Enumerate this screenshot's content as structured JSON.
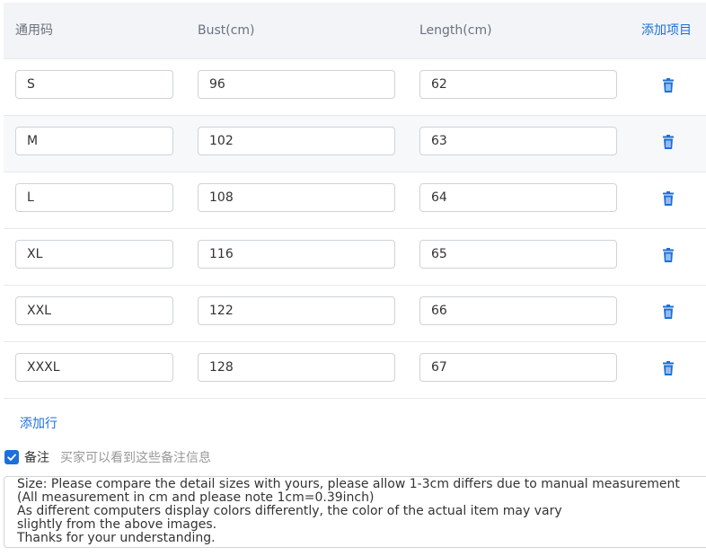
{
  "header": {
    "code_label": "通用码",
    "bust_label": "Bust(cm)",
    "length_label": "Length(cm)",
    "add_item_label": "添加项目"
  },
  "rows": [
    {
      "code": "S",
      "bust": "96",
      "length": "62"
    },
    {
      "code": "M",
      "bust": "102",
      "length": "63"
    },
    {
      "code": "L",
      "bust": "108",
      "length": "64"
    },
    {
      "code": "XL",
      "bust": "116",
      "length": "65"
    },
    {
      "code": "XXL",
      "bust": "122",
      "length": "66"
    },
    {
      "code": "XXXL",
      "bust": "128",
      "length": "67"
    }
  ],
  "add_row_label": "添加行",
  "note": {
    "checked": true,
    "label": "备注",
    "hint": "买家可以看到这些备注信息",
    "text": "Size: Please compare the detail sizes with yours, please allow 1-3cm differs due to manual measurement\n(All measurement in cm and please note 1cm=0.39inch)\nAs different computers display colors differently, the color of the actual item may vary\nslightly from the above images.\nThanks for your understanding."
  },
  "icons": {
    "delete": "trash-icon",
    "check": "check-icon"
  },
  "colors": {
    "accent": "#1e6fd9",
    "header_bg": "#f2f4f7",
    "alt_row_bg": "#f7f8fa"
  }
}
